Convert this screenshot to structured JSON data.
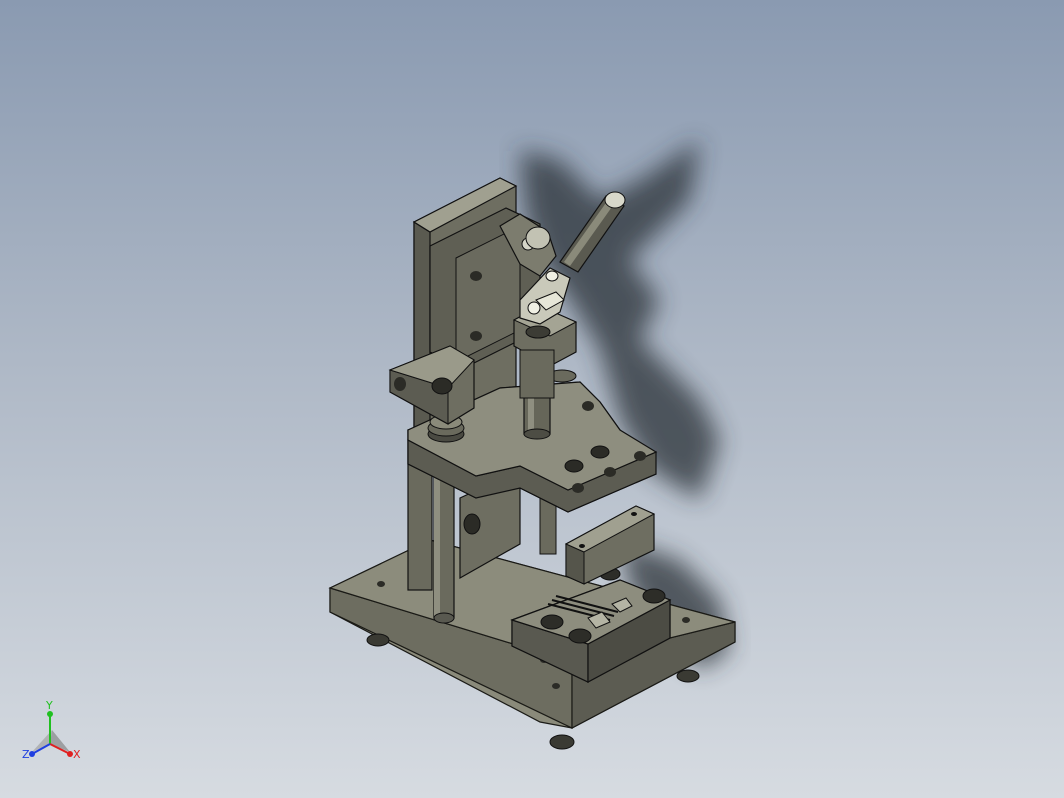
{
  "viewport": {
    "background_top": "#8a9ab1",
    "background_bottom": "#d6dbe1"
  },
  "model": {
    "body_color": "#7d7d6e",
    "dark_color": "#3d3d35",
    "light_color": "#a8a898"
  },
  "triad": {
    "x_label": "X",
    "y_label": "Y",
    "z_label": "Z",
    "x_color": "#e02020",
    "y_color": "#20c020",
    "z_color": "#2040e0"
  }
}
